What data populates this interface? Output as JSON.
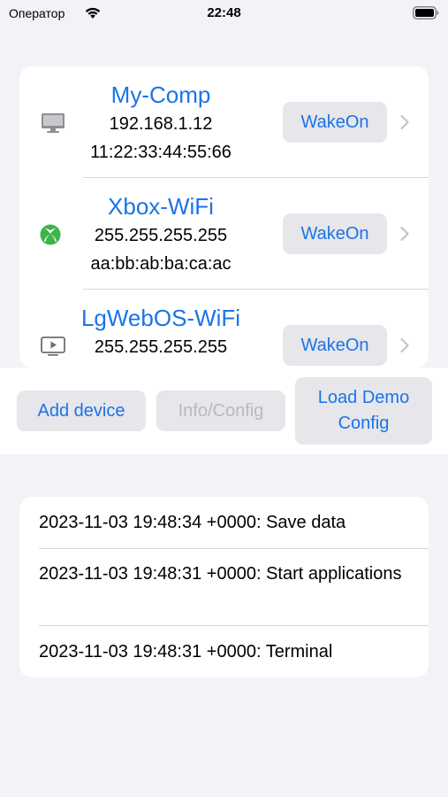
{
  "status_bar": {
    "carrier": "Оператор",
    "time": "22:48"
  },
  "devices": [
    {
      "icon": "desktop-computer-icon",
      "name": "My-Comp",
      "ip": "192.168.1.12",
      "mac": "11:22:33:44:55:66",
      "action": "WakeOn"
    },
    {
      "icon": "xbox-logo-icon",
      "name": "Xbox-WiFi",
      "ip": "255.255.255.255",
      "mac": "aa:bb:ab:ba:ca:ac",
      "action": "WakeOn"
    },
    {
      "icon": "tv-play-icon",
      "name": "LgWebOS-WiFi",
      "ip": "255.255.255.255",
      "action": "WakeOn"
    }
  ],
  "actions": {
    "add_device": "Add device",
    "info_config": "Info/Config",
    "load_demo_line1": "Load Demo",
    "load_demo_line2": "Config"
  },
  "log": [
    "2023-11-03 19:48:34 +0000: Save data",
    "2023-11-03 19:48:31 +0000: Start applications",
    "2023-11-03 19:48:31 +0000: Terminal"
  ],
  "colors": {
    "accent": "#1a74e8",
    "xbox_green": "#3cb44a",
    "background": "#f2f2f7",
    "button_fill": "#e6e6eb",
    "disabled_text": "#b9b9be"
  }
}
